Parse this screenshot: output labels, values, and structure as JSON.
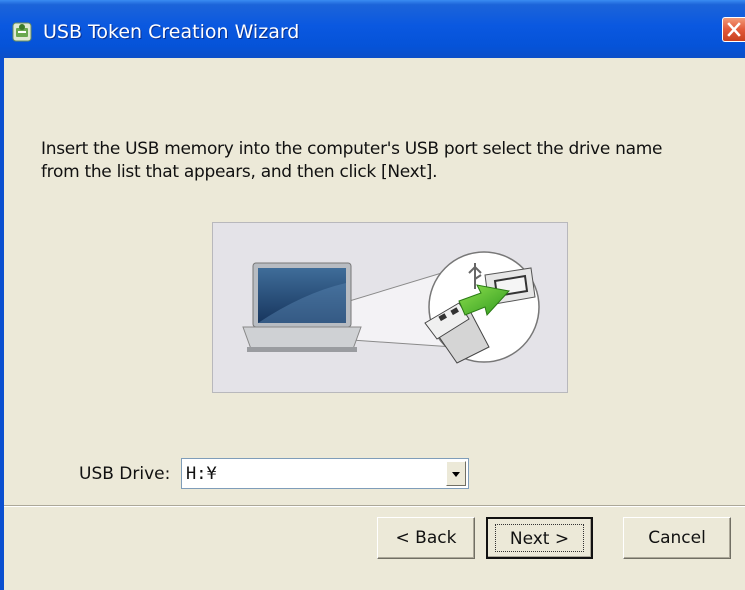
{
  "window": {
    "title": "USB Token Creation Wizard",
    "title_icon": "usb-token-app-icon",
    "close_icon": "close-icon"
  },
  "main": {
    "instructions": "Insert the USB memory into the computer's USB port  select the drive name\nfrom the list that appears, and then click [Next].",
    "illustration": "laptop-usb-insert-illustration"
  },
  "drive": {
    "label": "USB Drive:",
    "selected": "H:¥"
  },
  "buttons": {
    "back": "< Back",
    "next": "Next >",
    "cancel": "Cancel"
  },
  "colors": {
    "titlebar": "#0553d8",
    "window_bg": "#ece9d8",
    "close_button": "#e2593a"
  }
}
